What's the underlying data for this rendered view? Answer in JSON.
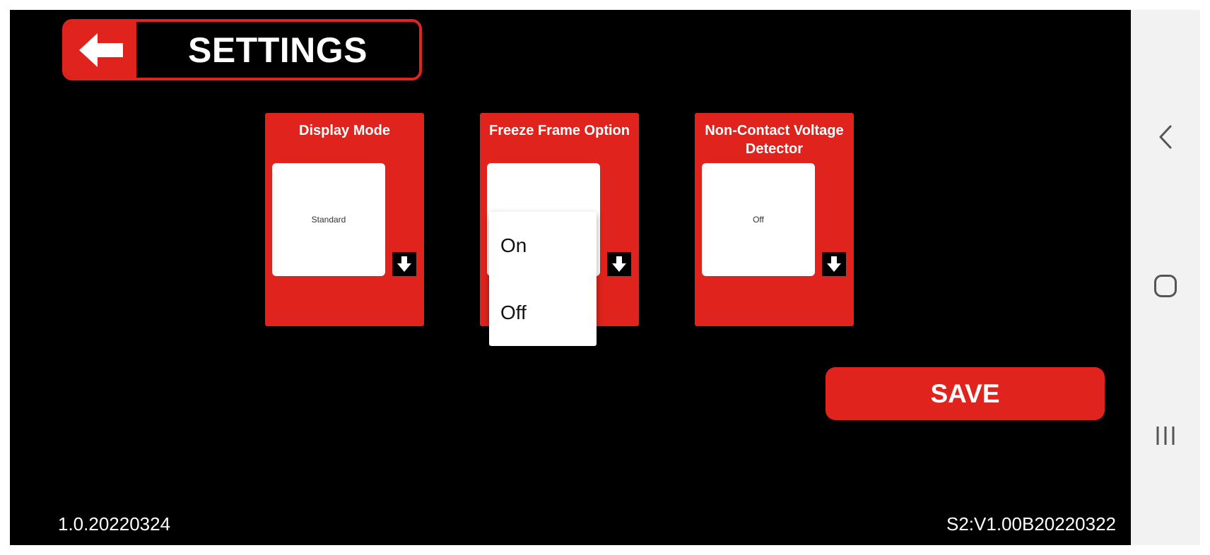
{
  "header": {
    "title": "SETTINGS",
    "back_icon": "arrow-left-icon"
  },
  "cards": [
    {
      "title": "Display Mode",
      "value": "Standard"
    },
    {
      "title": "Freeze Frame Option",
      "value": ""
    },
    {
      "title": "Non-Contact Voltage Detector",
      "value": "Off"
    }
  ],
  "dropdown": {
    "options": [
      "On",
      "Off"
    ]
  },
  "save_label": "SAVE",
  "versions": {
    "app": "1.0.20220324",
    "firmware": "S2:V1.00B20220322"
  },
  "navbar": {
    "icons": [
      "back-icon",
      "home-icon",
      "recent-apps-icon"
    ]
  },
  "colors": {
    "accent": "#e0241d",
    "background": "#000000",
    "navbar": "#f2f2f2"
  }
}
